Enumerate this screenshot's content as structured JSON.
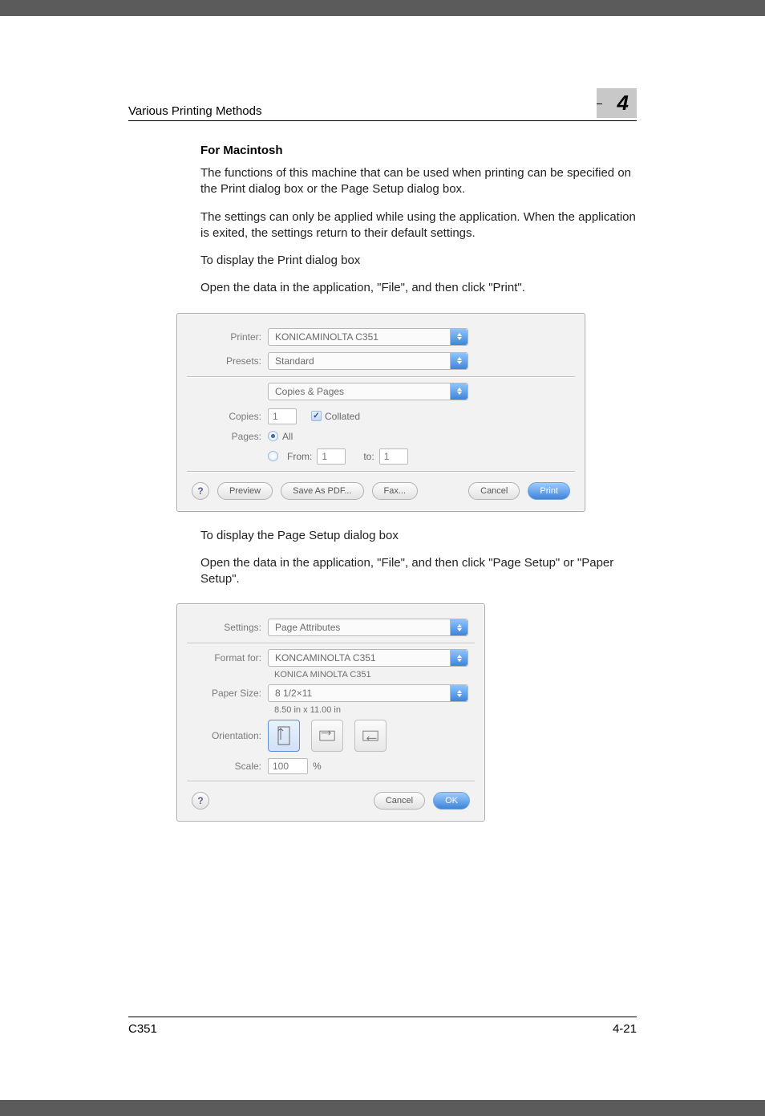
{
  "header": {
    "running_title": "Various Printing Methods",
    "chapter_number": "4"
  },
  "section": {
    "subheading": "For Macintosh"
  },
  "paragraphs": {
    "p1": "The functions of this machine that can be used when printing can be specified on the Print dialog box or the Page Setup dialog box.",
    "p2": "The settings can only be applied while using the application. When the application is exited, the settings return to their default settings.",
    "p3": "To display the Print dialog box",
    "p4": "Open the data in the application, \"File\", and then click \"Print\".",
    "p5": "To display the Page Setup dialog box",
    "p6": "Open the data in the application, \"File\", and then click \"Page Setup\" or \"Paper Setup\"."
  },
  "printDialog": {
    "labels": {
      "printer": "Printer:",
      "presets": "Presets:",
      "copies": "Copies:",
      "pages": "Pages:",
      "all": "All",
      "from": "From:",
      "to": "to:"
    },
    "printer_value": "KONICAMINOLTA C351",
    "presets_value": "Standard",
    "panel_value": "Copies & Pages",
    "copies_value": "1",
    "collated_label": "Collated",
    "from_value": "1",
    "to_value": "1",
    "buttons": {
      "preview": "Preview",
      "save_pdf": "Save As PDF...",
      "fax": "Fax...",
      "cancel": "Cancel",
      "print": "Print"
    }
  },
  "pageSetupDialog": {
    "labels": {
      "settings": "Settings:",
      "format_for": "Format for:",
      "paper_size": "Paper Size:",
      "orientation": "Orientation:",
      "scale": "Scale:"
    },
    "settings_value": "Page Attributes",
    "format_for_value": "KONCAMINOLTA C351",
    "printer_model_sub": "KONICA MINOLTA C351",
    "paper_size_value": "8 1/2×11",
    "paper_size_sub": "8.50 in x 11.00 in",
    "scale_value": "100",
    "scale_unit": "%",
    "buttons": {
      "cancel": "Cancel",
      "ok": "OK"
    }
  },
  "footer": {
    "model": "C351",
    "page_number": "4-21"
  }
}
